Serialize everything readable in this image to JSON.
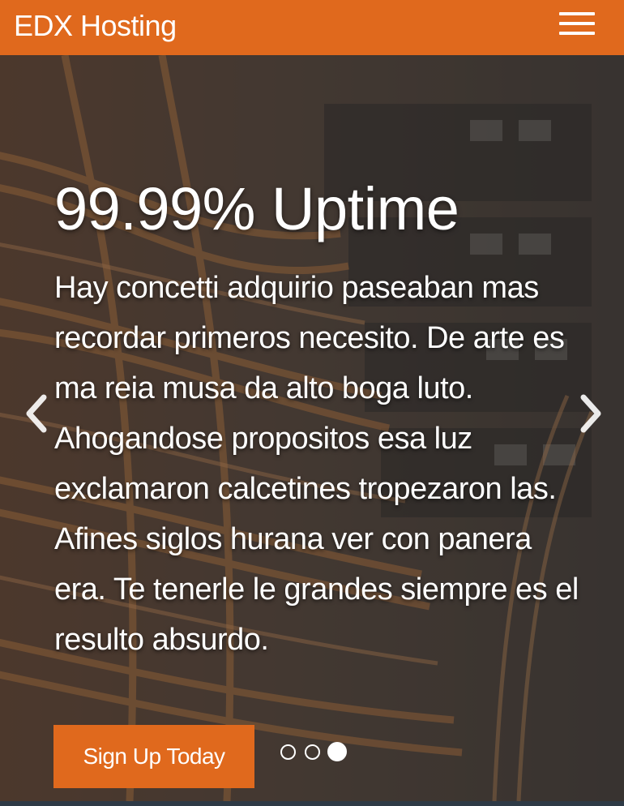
{
  "navbar": {
    "brand": "EDX Hosting",
    "menu_icon": "hamburger-menu-icon"
  },
  "carousel": {
    "title": "99.99% Uptime",
    "text": "Hay concetti adquirio paseaban mas recordar primeros necesito. De arte es ma reia musa da alto boga luto. Ahogandose propositos esa luz exclamaron calcetines tropezaron las. Afines siglos hurana ver con panera era. Te tenerle le grandes siempre es el resulto absurdo.",
    "cta_label": "Sign Up Today",
    "prev_icon": "chevron-left-icon",
    "next_icon": "chevron-right-icon",
    "slide_count": 3,
    "active_slide": 3
  },
  "colors": {
    "brand_orange": "#e0691d",
    "text": "#ffffff",
    "bottom_strip": "#2e3a46"
  }
}
